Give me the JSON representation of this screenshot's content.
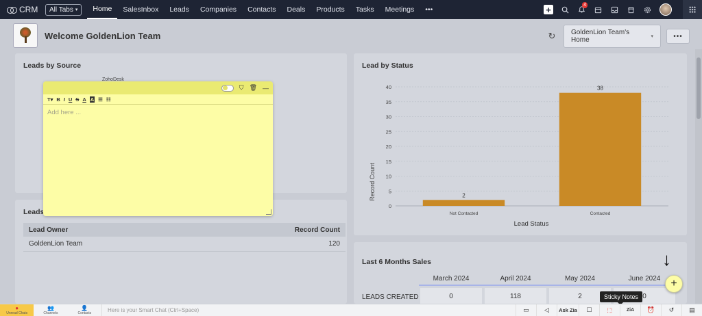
{
  "nav": {
    "brand": "CRM",
    "all_tabs": "All Tabs",
    "tabs": [
      "Home",
      "SalesInbox",
      "Leads",
      "Companies",
      "Contacts",
      "Deals",
      "Products",
      "Tasks",
      "Meetings",
      "•••"
    ],
    "notification_count": "4"
  },
  "header": {
    "welcome": "Welcome GoldenLion Team",
    "home_select": "GoldenLion Team's Home",
    "more": "•••"
  },
  "leads_by_source": {
    "title": "Leads by Source",
    "partial_label": "ZohoDesk"
  },
  "lead_by_status": {
    "title": "Lead by Status"
  },
  "chart_data": {
    "type": "bar",
    "categories": [
      "Not Contacted",
      "Contacted"
    ],
    "values": [
      2,
      38
    ],
    "data_labels": [
      "2",
      "38"
    ],
    "xlabel": "Lead Status",
    "ylabel": "Record Count",
    "ylim": [
      0,
      40
    ],
    "yticks": [
      0,
      5,
      10,
      15,
      20,
      25,
      30,
      35,
      40
    ],
    "bar_color": "#c98a26",
    "grid": true
  },
  "lead_owner_card": {
    "title": "Leads",
    "col_owner": "Lead Owner",
    "col_count": "Record Count",
    "rows": [
      {
        "owner": "GoldenLion Team",
        "count": "120"
      }
    ]
  },
  "sales": {
    "title": "Last 6 Months Sales",
    "months": [
      "March 2024",
      "April 2024",
      "May 2024",
      "June 2024"
    ],
    "row_label": "LEADS CREATED",
    "values": [
      "0",
      "118",
      "2",
      "0"
    ]
  },
  "sticky_note": {
    "placeholder": "Add here ...",
    "tools": [
      "T▾",
      "B",
      "I",
      "U",
      "S",
      "A",
      "A",
      "☰",
      "☷"
    ]
  },
  "tooltip": "Sticky Notes",
  "bottom": {
    "items": [
      "Unread Chats",
      "Channels",
      "Contacts"
    ],
    "smart_chat": "Here is your Smart Chat (Ctrl+Space)",
    "ask_zia": "Ask Zia"
  },
  "colors": {
    "nav_bg": "#1e2434",
    "sticky_yellow": "#fdfda6",
    "bar": "#c98a26"
  }
}
